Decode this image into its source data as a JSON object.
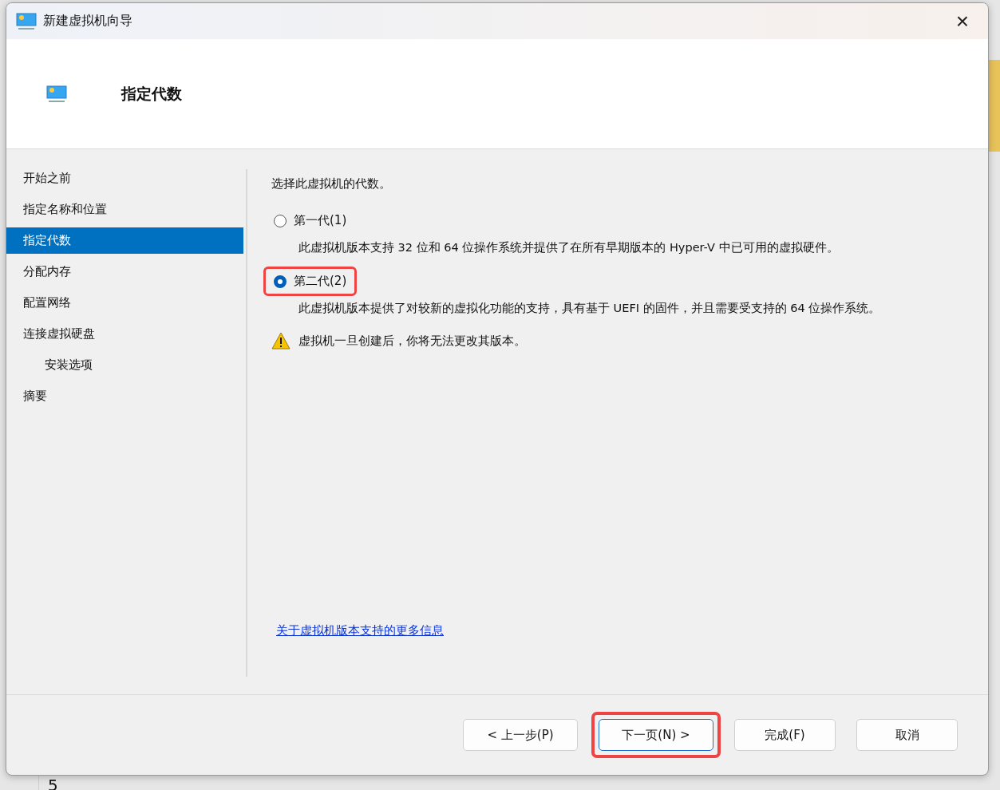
{
  "backdrop": {
    "bottom_text": "5"
  },
  "window": {
    "title": "新建虚拟机向导",
    "close": "×"
  },
  "header": {
    "title": "指定代数"
  },
  "sidebar": {
    "items": [
      {
        "label": "开始之前",
        "selected": false
      },
      {
        "label": "指定名称和位置",
        "selected": false
      },
      {
        "label": "指定代数",
        "selected": true
      },
      {
        "label": "分配内存",
        "selected": false
      },
      {
        "label": "配置网络",
        "selected": false
      },
      {
        "label": "连接虚拟硬盘",
        "selected": false,
        "children": [
          {
            "label": "安装选项",
            "selected": false
          }
        ]
      },
      {
        "label": "摘要",
        "selected": false
      }
    ]
  },
  "content": {
    "prompt": "选择此虚拟机的代数。",
    "options": [
      {
        "label": "第一代(1)",
        "selected": false,
        "highlighted": false,
        "description": "此虚拟机版本支持 32 位和 64 位操作系统并提供了在所有早期版本的 Hyper-V 中已可用的虚拟硬件。"
      },
      {
        "label": "第二代(2)",
        "selected": true,
        "highlighted": true,
        "description": "此虚拟机版本提供了对较新的虚拟化功能的支持，具有基于 UEFI 的固件，并且需要受支持的 64 位操作系统。"
      }
    ],
    "warning": "虚拟机一旦创建后，你将无法更改其版本。",
    "link": "关于虚拟机版本支持的更多信息"
  },
  "buttons": [
    {
      "label": "< 上一步(P)",
      "focused": false,
      "highlighted": false
    },
    {
      "label": "下一页(N) >",
      "focused": true,
      "highlighted": true
    },
    {
      "label": "完成(F)",
      "focused": false,
      "highlighted": false
    },
    {
      "label": "取消",
      "focused": false,
      "highlighted": false
    }
  ]
}
